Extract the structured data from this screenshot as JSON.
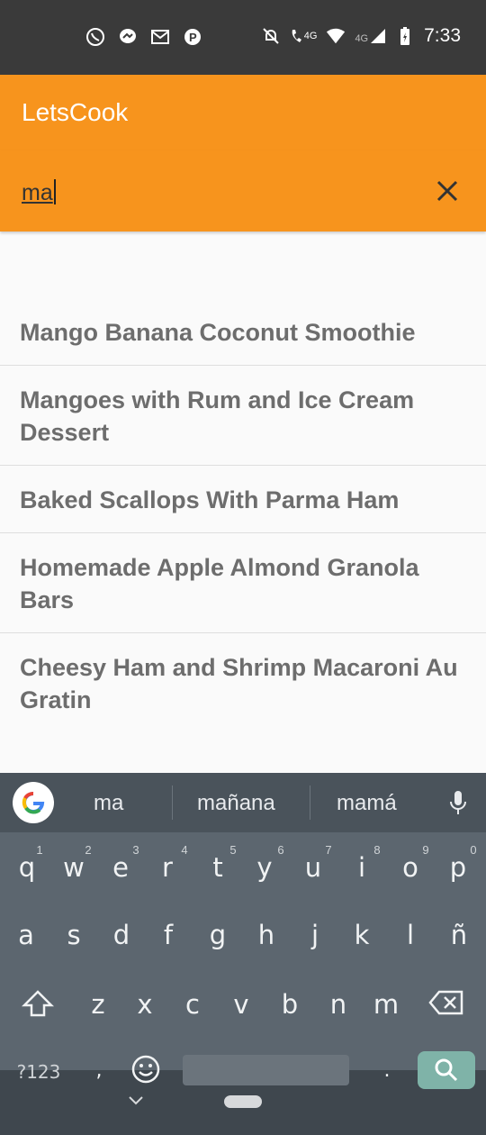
{
  "status_bar": {
    "time": "7:33",
    "left_icons": [
      "whatsapp-icon",
      "messenger-icon",
      "gmail-icon",
      "paytm-icon"
    ],
    "right_icons": [
      "mute-icon",
      "volte-call-icon",
      "wifi-icon",
      "signal-icon",
      "battery-icon"
    ],
    "volte_label": "4G",
    "network_label": "4G"
  },
  "app_bar": {
    "title": "LetsCook"
  },
  "search": {
    "query": "ma",
    "clear_icon": "close-icon"
  },
  "results": [
    {
      "title": "Mango Banana Coconut Smoothie"
    },
    {
      "title": "Mangoes with Rum and Ice Cream Dessert"
    },
    {
      "title": "Baked Scallops With Parma Ham"
    },
    {
      "title": "Homemade Apple Almond Granola Bars"
    },
    {
      "title": "Cheesy Ham and Shrimp Macaroni Au Gratin"
    }
  ],
  "keyboard": {
    "suggestions": [
      "ma",
      "mañana",
      "mamá"
    ],
    "row1": [
      "q",
      "w",
      "e",
      "r",
      "t",
      "y",
      "u",
      "i",
      "o",
      "p"
    ],
    "row1_hints": [
      "1",
      "2",
      "3",
      "4",
      "5",
      "6",
      "7",
      "8",
      "9",
      "0"
    ],
    "row2": [
      "a",
      "s",
      "d",
      "f",
      "g",
      "h",
      "j",
      "k",
      "l",
      "ñ"
    ],
    "row3": [
      "z",
      "x",
      "c",
      "v",
      "b",
      "n",
      "m"
    ],
    "symbols_label": "?123",
    "comma": ",",
    "period": "."
  }
}
